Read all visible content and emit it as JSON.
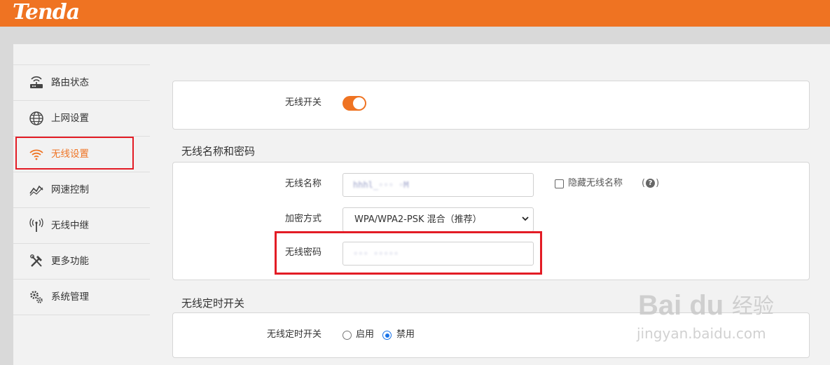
{
  "brand": {
    "logo": "Tenda",
    "accent": "#ef7322",
    "highlight": "#e31c25"
  },
  "sidebar": {
    "items": [
      {
        "label": "路由状态",
        "icon": "router-icon"
      },
      {
        "label": "上网设置",
        "icon": "globe-icon"
      },
      {
        "label": "无线设置",
        "icon": "wifi-icon",
        "active": true
      },
      {
        "label": "网速控制",
        "icon": "speed-chart-icon"
      },
      {
        "label": "无线中继",
        "icon": "antenna-icon"
      },
      {
        "label": "更多功能",
        "icon": "tools-icon"
      },
      {
        "label": "系统管理",
        "icon": "gears-icon"
      }
    ]
  },
  "wireless_switch": {
    "label": "无线开关",
    "enabled": true
  },
  "ssid_section": {
    "title": "无线名称和密码",
    "name_label": "无线名称",
    "name_value": "hhhl_◦◦◦ ◦M",
    "hide_checkbox_label": "隐藏无线名称",
    "hide_checked": false,
    "help_icon": "question-icon",
    "encryption_label": "加密方式",
    "encryption_value": "WPA/WPA2-PSK 混合（推荐）",
    "password_label": "无线密码",
    "password_value": "◦◦◦ ◦◦◦◦◦"
  },
  "timer_section": {
    "title": "无线定时开关",
    "label": "无线定时开关",
    "options": [
      "启用",
      "禁用"
    ],
    "selected": "禁用"
  },
  "watermark": {
    "main": "Bai du",
    "cn": "经验",
    "url": "jingyan.baidu.com"
  }
}
